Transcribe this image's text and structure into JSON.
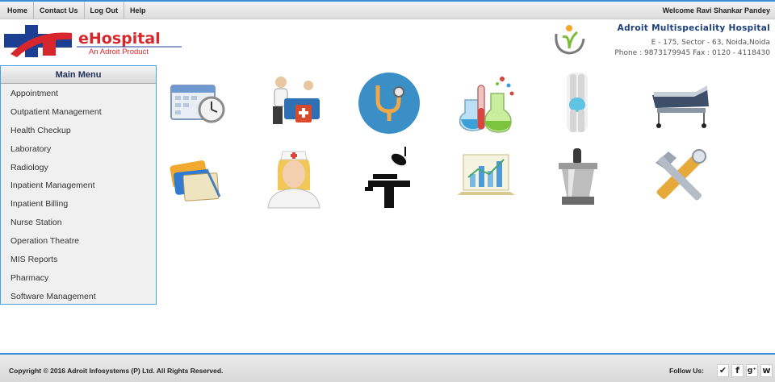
{
  "topbar": {
    "nav": [
      "Home",
      "Contact Us",
      "Log Out",
      "Help"
    ],
    "welcome": "Welcome Ravi Shankar Pandey"
  },
  "header": {
    "logo_text": "eHospital",
    "logo_tagline": "An Adroit Product",
    "hospital_name": "Adroit Multispeciality Hospital",
    "address_line1": "E - 175, Sector - 63, Noida,Noida",
    "address_line2": "Phone : 9873179945 Fax : 0120 - 4118430"
  },
  "menu": {
    "title": "Main Menu",
    "items": [
      "Appointment",
      "Outpatient Management",
      "Health Checkup",
      "Laboratory",
      "Radiology",
      "Inpatient Management",
      "Inpatient Billing",
      "Nurse Station",
      "Operation Theatre",
      "MIS Reports",
      "Pharmacy",
      "Software Management"
    ]
  },
  "tiles": [
    {
      "icon": "calendar-clock-icon"
    },
    {
      "icon": "doctor-desk-icon"
    },
    {
      "icon": "stethoscope-icon"
    },
    {
      "icon": "lab-flasks-icon"
    },
    {
      "icon": "xray-knee-icon"
    },
    {
      "icon": "hospital-bed-icon"
    },
    {
      "icon": "billing-cards-icon"
    },
    {
      "icon": "nurse-icon"
    },
    {
      "icon": "operation-table-icon"
    },
    {
      "icon": "report-chart-icon"
    },
    {
      "icon": "mortar-pestle-icon"
    },
    {
      "icon": "tools-icon"
    }
  ],
  "footer": {
    "copyright": "Copyright © 2016 Adroit Infosystems (P) Ltd. All Rights Reserved.",
    "follow": "Follow Us:",
    "social": [
      "twitter-icon",
      "facebook-icon",
      "googleplus-icon",
      "w-icon"
    ]
  }
}
